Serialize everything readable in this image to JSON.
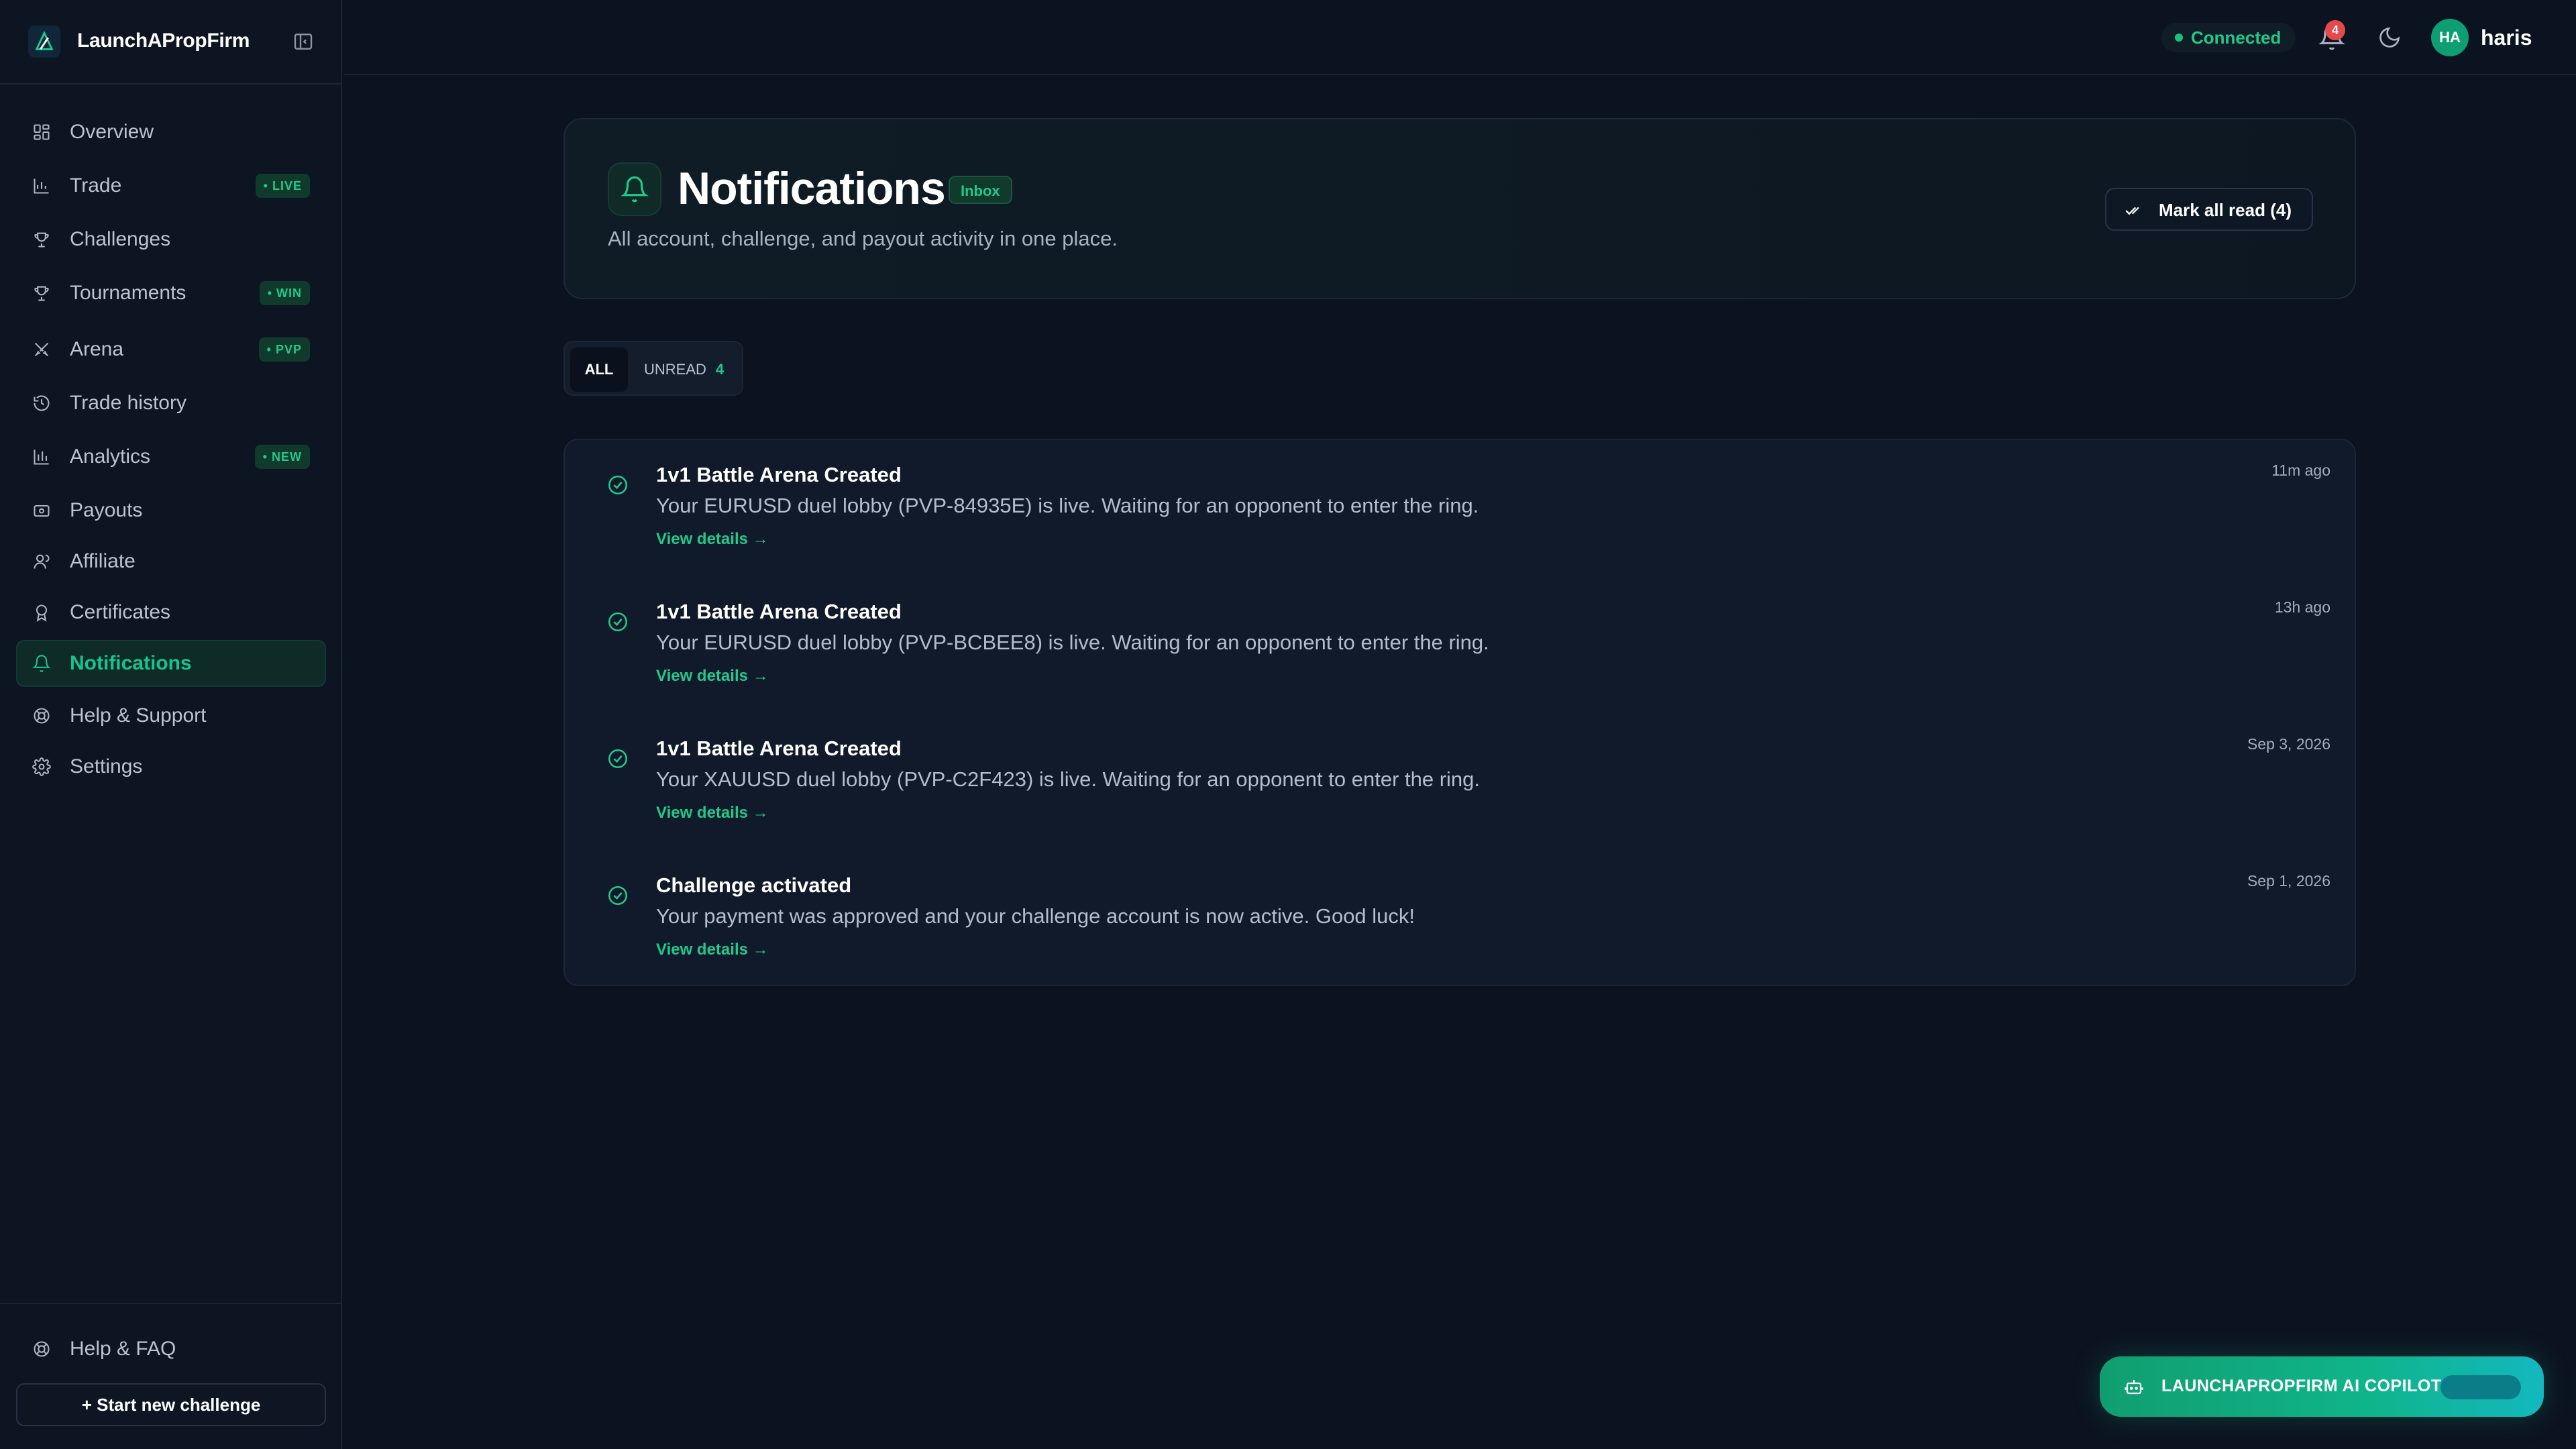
{
  "brand": {
    "name": "LaunchAPropFirm"
  },
  "sidebar": {
    "items": [
      {
        "label": "Overview"
      },
      {
        "label": "Trade",
        "badge": "LIVE"
      },
      {
        "label": "Challenges"
      },
      {
        "label": "Tournaments",
        "badge": "WIN"
      },
      {
        "label": "Arena",
        "badge": "PVP"
      },
      {
        "label": "Trade history"
      },
      {
        "label": "Analytics",
        "badge": "NEW"
      },
      {
        "label": "Payouts"
      },
      {
        "label": "Affiliate"
      },
      {
        "label": "Certificates"
      },
      {
        "label": "Notifications",
        "active": true
      },
      {
        "label": "Help & Support"
      },
      {
        "label": "Settings"
      }
    ],
    "help_faq": "Help & FAQ",
    "start_button": "+ Start new challenge"
  },
  "topbar": {
    "status": "Connected",
    "notification_count": "4",
    "avatar_initials": "HA",
    "username": "haris"
  },
  "header": {
    "title": "Notifications",
    "pill": "Inbox",
    "subtitle": "All account, challenge, and payout activity in one place.",
    "mark_all_read": "Mark all read (4)"
  },
  "tabs": {
    "all": "ALL",
    "unread": "UNREAD",
    "unread_count": "4"
  },
  "notifications": [
    {
      "title": "1v1 Battle Arena Created",
      "body": "Your EURUSD duel lobby (PVP-84935E) is live. Waiting for an opponent to enter the ring.",
      "link": "View details →",
      "time": "11m ago"
    },
    {
      "title": "1v1 Battle Arena Created",
      "body": "Your EURUSD duel lobby (PVP-BCBEE8) is live. Waiting for an opponent to enter the ring.",
      "link": "View details →",
      "time": "13h ago"
    },
    {
      "title": "1v1 Battle Arena Created",
      "body": "Your XAUUSD duel lobby (PVP-C2F423) is live. Waiting for an opponent to enter the ring.",
      "link": "View details →",
      "time": "Sep 3, 2026"
    },
    {
      "title": "Challenge activated",
      "body": "Your payment was approved and your challenge account is now active. Good luck!",
      "link": "View details →",
      "time": "Sep 1, 2026"
    }
  ],
  "copilot": {
    "label": "LAUNCHAPROPFIRM AI COPILOT"
  },
  "colors": {
    "accent": "#21c98b",
    "background": "#0c1320",
    "alert": "#e5484d"
  },
  "icons": {
    "sidebar": [
      "grid-icon",
      "chart-bar-icon",
      "trophy-icon",
      "trophy-icon",
      "swords-icon",
      "history-icon",
      "analytics-icon",
      "wallet-icon",
      "users-icon",
      "award-icon",
      "bell-icon",
      "lifebuoy-icon",
      "gear-icon"
    ]
  }
}
